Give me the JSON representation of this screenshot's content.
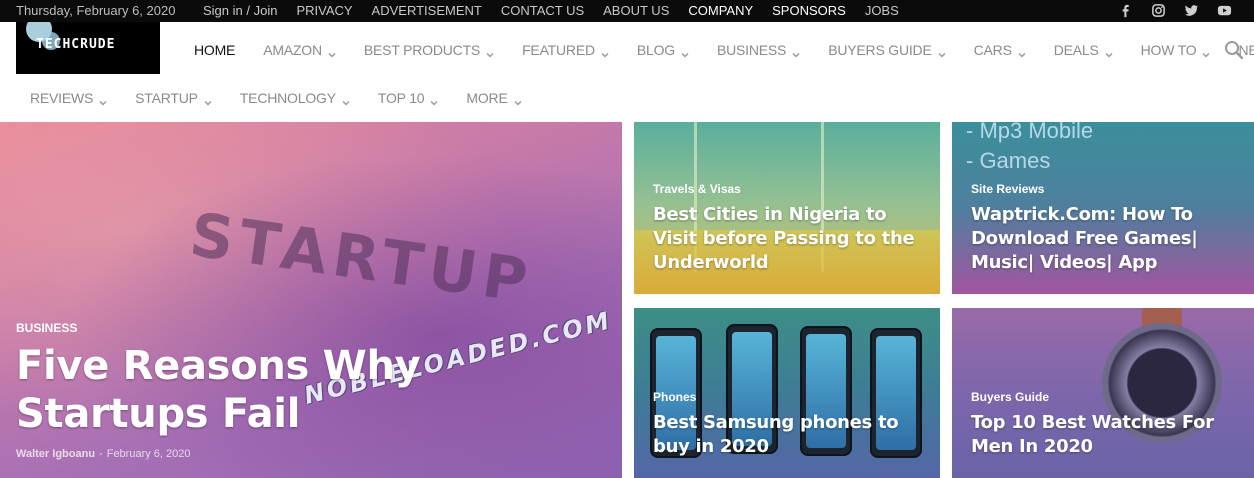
{
  "topbar": {
    "date": "Thursday, February 6, 2020",
    "links": [
      {
        "label": "Sign in / Join",
        "bright": false
      },
      {
        "label": "PRIVACY",
        "bright": false
      },
      {
        "label": "ADVERTISEMENT",
        "bright": false
      },
      {
        "label": "CONTACT US",
        "bright": false
      },
      {
        "label": "ABOUT US",
        "bright": false
      },
      {
        "label": "COMPANY",
        "bright": true
      },
      {
        "label": "SPONSORS",
        "bright": true
      },
      {
        "label": "JOBS",
        "bright": false
      }
    ],
    "social": [
      "facebook-icon",
      "instagram-icon",
      "twitter-icon",
      "youtube-icon"
    ]
  },
  "logo": {
    "text": "TECHCRUDE"
  },
  "nav": {
    "row1": [
      {
        "label": "HOME",
        "active": true,
        "dropdown": false
      },
      {
        "label": "AMAZON",
        "dropdown": true
      },
      {
        "label": "BEST PRODUCTS",
        "dropdown": true
      },
      {
        "label": "FEATURED",
        "dropdown": true
      },
      {
        "label": "BLOG",
        "dropdown": true
      },
      {
        "label": "BUSINESS",
        "dropdown": true
      },
      {
        "label": "BUYERS GUIDE",
        "dropdown": true
      },
      {
        "label": "CARS",
        "dropdown": true
      },
      {
        "label": "DEALS",
        "dropdown": true
      },
      {
        "label": "HOW TO",
        "dropdown": true
      },
      {
        "label": "NEWS",
        "dropdown": true
      }
    ],
    "row2": [
      {
        "label": "REVIEWS",
        "dropdown": true
      },
      {
        "label": "STARTUP",
        "dropdown": true
      },
      {
        "label": "TECHNOLOGY",
        "dropdown": true
      },
      {
        "label": "TOP 10",
        "dropdown": true
      },
      {
        "label": "MORE",
        "dropdown": true
      }
    ]
  },
  "hero": {
    "main": {
      "category": "BUSINESS",
      "title": "Five Reasons Why Startups Fail",
      "author": "Walter Igboanu",
      "separator": "-",
      "date": "February 6, 2020",
      "image_text": "STARTUP",
      "watermark": "NOBLELOADED.COM"
    },
    "tiles": [
      {
        "category": "Travels & Visas",
        "title": "Best Cities in Nigeria to Visit before Passing to the Underworld"
      },
      {
        "category": "Site Reviews",
        "title": "Waptrick.Com: How To Download Free Games| Music| Videos| App"
      },
      {
        "category": "Phones",
        "title": "Best Samsung phones to buy in 2020"
      },
      {
        "category": "Buyers Guide",
        "title": "Top 10 Best Watches For Men In 2020"
      }
    ],
    "waptrick_image_text": [
      "- Mp3 Mobile",
      "- Games"
    ]
  },
  "colors": {
    "topbar_bg": "#0b0b0b",
    "nav_text": "#8a8a8a",
    "nav_active": "#111111"
  }
}
